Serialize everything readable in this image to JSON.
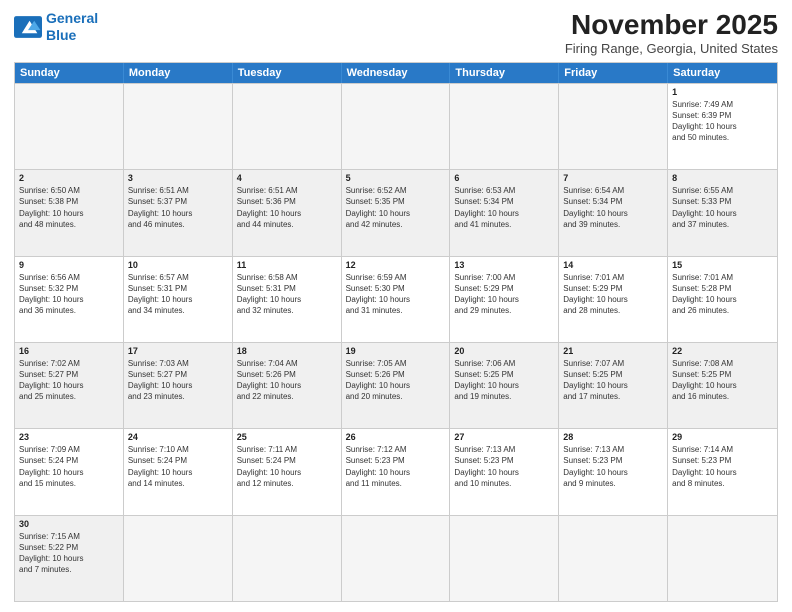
{
  "logo": {
    "line1": "General",
    "line2": "Blue"
  },
  "title": "November 2025",
  "subtitle": "Firing Range, Georgia, United States",
  "days_of_week": [
    "Sunday",
    "Monday",
    "Tuesday",
    "Wednesday",
    "Thursday",
    "Friday",
    "Saturday"
  ],
  "weeks": [
    [
      {
        "day": "",
        "info": ""
      },
      {
        "day": "",
        "info": ""
      },
      {
        "day": "",
        "info": ""
      },
      {
        "day": "",
        "info": ""
      },
      {
        "day": "",
        "info": ""
      },
      {
        "day": "",
        "info": ""
      },
      {
        "day": "1",
        "info": "Sunrise: 7:49 AM\nSunset: 6:39 PM\nDaylight: 10 hours\nand 50 minutes."
      }
    ],
    [
      {
        "day": "2",
        "info": "Sunrise: 6:50 AM\nSunset: 5:38 PM\nDaylight: 10 hours\nand 48 minutes."
      },
      {
        "day": "3",
        "info": "Sunrise: 6:51 AM\nSunset: 5:37 PM\nDaylight: 10 hours\nand 46 minutes."
      },
      {
        "day": "4",
        "info": "Sunrise: 6:51 AM\nSunset: 5:36 PM\nDaylight: 10 hours\nand 44 minutes."
      },
      {
        "day": "5",
        "info": "Sunrise: 6:52 AM\nSunset: 5:35 PM\nDaylight: 10 hours\nand 42 minutes."
      },
      {
        "day": "6",
        "info": "Sunrise: 6:53 AM\nSunset: 5:34 PM\nDaylight: 10 hours\nand 41 minutes."
      },
      {
        "day": "7",
        "info": "Sunrise: 6:54 AM\nSunset: 5:34 PM\nDaylight: 10 hours\nand 39 minutes."
      },
      {
        "day": "8",
        "info": "Sunrise: 6:55 AM\nSunset: 5:33 PM\nDaylight: 10 hours\nand 37 minutes."
      }
    ],
    [
      {
        "day": "9",
        "info": "Sunrise: 6:56 AM\nSunset: 5:32 PM\nDaylight: 10 hours\nand 36 minutes."
      },
      {
        "day": "10",
        "info": "Sunrise: 6:57 AM\nSunset: 5:31 PM\nDaylight: 10 hours\nand 34 minutes."
      },
      {
        "day": "11",
        "info": "Sunrise: 6:58 AM\nSunset: 5:31 PM\nDaylight: 10 hours\nand 32 minutes."
      },
      {
        "day": "12",
        "info": "Sunrise: 6:59 AM\nSunset: 5:30 PM\nDaylight: 10 hours\nand 31 minutes."
      },
      {
        "day": "13",
        "info": "Sunrise: 7:00 AM\nSunset: 5:29 PM\nDaylight: 10 hours\nand 29 minutes."
      },
      {
        "day": "14",
        "info": "Sunrise: 7:01 AM\nSunset: 5:29 PM\nDaylight: 10 hours\nand 28 minutes."
      },
      {
        "day": "15",
        "info": "Sunrise: 7:01 AM\nSunset: 5:28 PM\nDaylight: 10 hours\nand 26 minutes."
      }
    ],
    [
      {
        "day": "16",
        "info": "Sunrise: 7:02 AM\nSunset: 5:27 PM\nDaylight: 10 hours\nand 25 minutes."
      },
      {
        "day": "17",
        "info": "Sunrise: 7:03 AM\nSunset: 5:27 PM\nDaylight: 10 hours\nand 23 minutes."
      },
      {
        "day": "18",
        "info": "Sunrise: 7:04 AM\nSunset: 5:26 PM\nDaylight: 10 hours\nand 22 minutes."
      },
      {
        "day": "19",
        "info": "Sunrise: 7:05 AM\nSunset: 5:26 PM\nDaylight: 10 hours\nand 20 minutes."
      },
      {
        "day": "20",
        "info": "Sunrise: 7:06 AM\nSunset: 5:25 PM\nDaylight: 10 hours\nand 19 minutes."
      },
      {
        "day": "21",
        "info": "Sunrise: 7:07 AM\nSunset: 5:25 PM\nDaylight: 10 hours\nand 17 minutes."
      },
      {
        "day": "22",
        "info": "Sunrise: 7:08 AM\nSunset: 5:25 PM\nDaylight: 10 hours\nand 16 minutes."
      }
    ],
    [
      {
        "day": "23",
        "info": "Sunrise: 7:09 AM\nSunset: 5:24 PM\nDaylight: 10 hours\nand 15 minutes."
      },
      {
        "day": "24",
        "info": "Sunrise: 7:10 AM\nSunset: 5:24 PM\nDaylight: 10 hours\nand 14 minutes."
      },
      {
        "day": "25",
        "info": "Sunrise: 7:11 AM\nSunset: 5:24 PM\nDaylight: 10 hours\nand 12 minutes."
      },
      {
        "day": "26",
        "info": "Sunrise: 7:12 AM\nSunset: 5:23 PM\nDaylight: 10 hours\nand 11 minutes."
      },
      {
        "day": "27",
        "info": "Sunrise: 7:13 AM\nSunset: 5:23 PM\nDaylight: 10 hours\nand 10 minutes."
      },
      {
        "day": "28",
        "info": "Sunrise: 7:13 AM\nSunset: 5:23 PM\nDaylight: 10 hours\nand 9 minutes."
      },
      {
        "day": "29",
        "info": "Sunrise: 7:14 AM\nSunset: 5:23 PM\nDaylight: 10 hours\nand 8 minutes."
      }
    ],
    [
      {
        "day": "30",
        "info": "Sunrise: 7:15 AM\nSunset: 5:22 PM\nDaylight: 10 hours\nand 7 minutes."
      },
      {
        "day": "",
        "info": ""
      },
      {
        "day": "",
        "info": ""
      },
      {
        "day": "",
        "info": ""
      },
      {
        "day": "",
        "info": ""
      },
      {
        "day": "",
        "info": ""
      },
      {
        "day": "",
        "info": ""
      }
    ]
  ]
}
